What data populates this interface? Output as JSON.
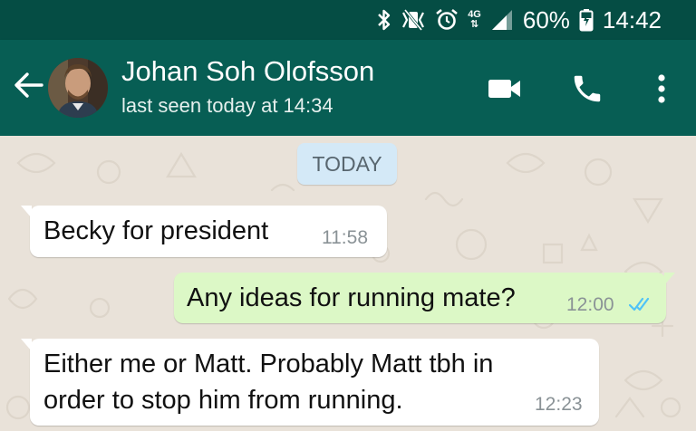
{
  "status_bar": {
    "network": "4G",
    "battery": "60%",
    "time": "14:42",
    "icons": [
      "bluetooth-icon",
      "vibrate-icon",
      "alarm-icon",
      "signal-icon",
      "battery-icon"
    ]
  },
  "header": {
    "contact_name": "Johan Soh Olofsson",
    "last_seen": "last seen today at 14:34",
    "icons": [
      "back-arrow-icon",
      "video-call-icon",
      "voice-call-icon",
      "more-options-icon"
    ]
  },
  "chat": {
    "date_label": "TODAY",
    "messages": [
      {
        "direction": "incoming",
        "text": "Becky for president",
        "time": "11:58"
      },
      {
        "direction": "outgoing",
        "text": "Any ideas for running mate?",
        "time": "12:00",
        "status": "read"
      },
      {
        "direction": "incoming",
        "text": "Either me or Matt. Probably Matt tbh in order to stop him from running.",
        "time": "12:23"
      }
    ]
  },
  "colors": {
    "status_bar": "#054d44",
    "app_bar": "#075e54",
    "chat_background": "#e9e2d9",
    "incoming_bubble": "#ffffff",
    "outgoing_bubble": "#dcf8c6",
    "date_chip": "#d4e9f7",
    "read_ticks": "#4fc3f7"
  }
}
